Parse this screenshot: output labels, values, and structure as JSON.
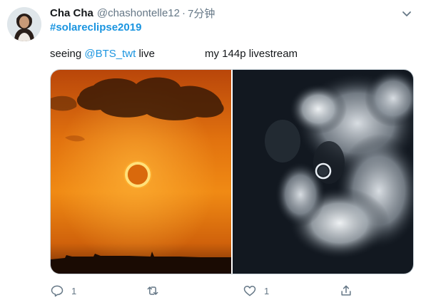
{
  "user": {
    "display_name": "Cha Cha",
    "handle": "@chashontelle12",
    "separator": "·",
    "time": "7分钟"
  },
  "tweet": {
    "hashtag": "#solareclipse2019",
    "caption_left_prefix": "seeing ",
    "caption_left_mention": "@BTS_twt",
    "caption_left_suffix": " live",
    "caption_right": "my 144p livestream"
  },
  "actions": {
    "reply_count": "1",
    "like_count": "1"
  },
  "icons": {
    "reply": "reply-icon",
    "retweet": "retweet-icon",
    "like": "heart-icon",
    "share": "share-icon",
    "caret": "chevron-down-icon"
  },
  "colors": {
    "link": "#1b95e0",
    "muted": "#657786"
  }
}
